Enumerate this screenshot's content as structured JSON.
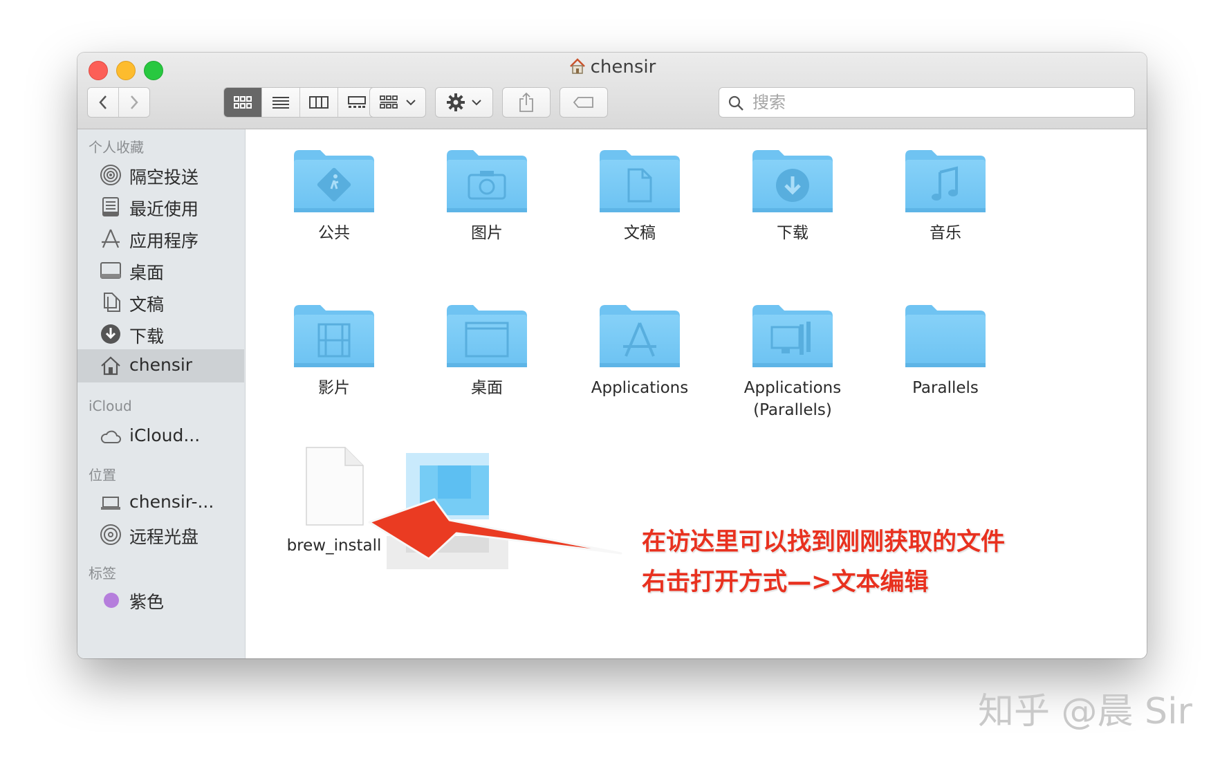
{
  "window": {
    "title": "chensir"
  },
  "toolbar": {
    "search_placeholder": "搜索"
  },
  "sidebar": {
    "favorites_header": "个人收藏",
    "favorites": [
      {
        "label": "隔空投送",
        "icon": "airdrop-icon"
      },
      {
        "label": "最近使用",
        "icon": "recents-icon"
      },
      {
        "label": "应用程序",
        "icon": "applications-icon"
      },
      {
        "label": "桌面",
        "icon": "desktop-icon"
      },
      {
        "label": "文稿",
        "icon": "documents-icon"
      },
      {
        "label": "下载",
        "icon": "downloads-icon"
      },
      {
        "label": "chensir",
        "icon": "home-icon",
        "selected": true
      }
    ],
    "icloud_header": "iCloud",
    "icloud": [
      {
        "label": "iCloud...",
        "icon": "cloud-icon"
      }
    ],
    "locations_header": "位置",
    "locations": [
      {
        "label": "chensir-...",
        "icon": "laptop-icon"
      },
      {
        "label": "远程光盘",
        "icon": "disc-icon"
      }
    ],
    "tags_header": "标签",
    "tags": [
      {
        "label": "紫色",
        "color": "#b57edc"
      }
    ]
  },
  "files": [
    {
      "label": "公共",
      "icon": "public-folder-icon"
    },
    {
      "label": "图片",
      "icon": "pictures-folder-icon"
    },
    {
      "label": "文稿",
      "icon": "documents-folder-icon"
    },
    {
      "label": "下载",
      "icon": "downloads-folder-icon"
    },
    {
      "label": "音乐",
      "icon": "music-folder-icon"
    },
    {
      "label": "影片",
      "icon": "movies-folder-icon"
    },
    {
      "label": "桌面",
      "icon": "desktop-folder-icon"
    },
    {
      "label": "Applications",
      "icon": "applications-folder-icon"
    },
    {
      "label": "Applications\n(Parallels)",
      "icon": "parallels-apps-folder-icon"
    },
    {
      "label": "Parallels",
      "icon": "folder-icon"
    },
    {
      "label": "brew_install",
      "icon": "document-icon"
    }
  ],
  "annotation": {
    "line1": "在访达里可以找到刚刚获取的文件",
    "line2": "右击打开方式—>文本编辑",
    "color": "#e8311f"
  },
  "watermark": "知乎 @晨 Sir",
  "colors": {
    "folder": "#7ccbf5",
    "sidebar_bg": "#e3e7ea",
    "selected_row": "#cdd1d4"
  }
}
